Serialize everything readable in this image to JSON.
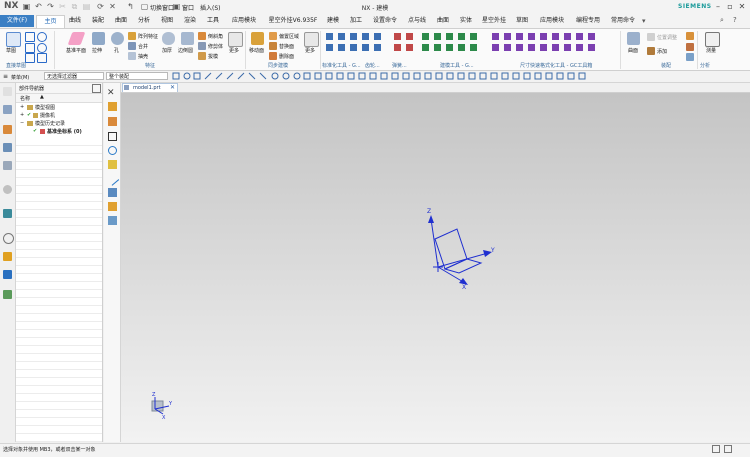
{
  "app": {
    "logo": "NX",
    "title": "NX - 建模",
    "brand": "SIEMENS",
    "quick_access": {
      "switch_window": "切换窗口",
      "window": "窗口",
      "insert": "插入(S)"
    }
  },
  "tabs": [
    {
      "label": "文件(F)"
    },
    {
      "label": "主页"
    },
    {
      "label": "曲线"
    },
    {
      "label": "装配"
    },
    {
      "label": "曲面"
    },
    {
      "label": "分析"
    },
    {
      "label": "视图"
    },
    {
      "label": "渲染"
    },
    {
      "label": "工具"
    },
    {
      "label": "应用模块"
    },
    {
      "label": "星空外挂V6.935F"
    },
    {
      "label": "建模"
    },
    {
      "label": "加工"
    },
    {
      "label": "设置命令"
    },
    {
      "label": "点与线"
    },
    {
      "label": "曲面"
    },
    {
      "label": "实体"
    },
    {
      "label": "星空外挂"
    },
    {
      "label": "草图"
    },
    {
      "label": "应用模块"
    },
    {
      "label": "编程专用"
    },
    {
      "label": "常用命令"
    }
  ],
  "ribbon": {
    "sketch": "草图",
    "direct_sketch": "直接草图",
    "datum_plane": "基准平面",
    "extrude": "拉伸",
    "hole": "孔",
    "array_feature": "阵列特征",
    "unite": "合并",
    "shell": "抽壳",
    "feature_group": "特征",
    "thicken": "加厚",
    "edge_blend": "边倒圆",
    "chamfer": "倒斜角",
    "trim_body": "修剪体",
    "draft": "拔模",
    "more1": "更多",
    "move_face": "移动面",
    "offset_region": "偏置区域",
    "replace_face": "替换面",
    "delete_face": "删除面",
    "more2": "更多",
    "sync_group": "同步建模",
    "std_tools": "标准化工具 - G...",
    "gear": "齿轮...",
    "spring": "弹簧...",
    "mold_tools": "建模工具 - G...",
    "dim_tools": "尺寸快速格式化工具 - GC工具箱",
    "surface": "曲面",
    "add": "添加",
    "assembly_group": "装配",
    "measure": "测量",
    "analysis_group": "分析",
    "snapshot": "位置调整"
  },
  "toolbar2": {
    "menu": "菜单(M)",
    "filter": "无选择过滤器",
    "assembly_scope": "整个装配"
  },
  "navigator": {
    "title": "部件导航器",
    "col_name": "名称",
    "items": [
      {
        "label": "模型视图"
      },
      {
        "label": "摄像机"
      },
      {
        "label": "模型历史记录"
      },
      {
        "label": "基准坐标系 (0)"
      }
    ]
  },
  "graphics": {
    "tab_label": "model1.prt",
    "triad_main": {
      "z": "Z",
      "y": "Y",
      "x": "X"
    },
    "triad_corner": {
      "z": "Z",
      "y": "Y",
      "x": "X"
    }
  },
  "status": {
    "prompt": "选择对象并使用 MB3，或者双击某一对象"
  },
  "colors": {
    "accent": "#3b7fc4",
    "triad_blue": "#1f2fd0"
  }
}
